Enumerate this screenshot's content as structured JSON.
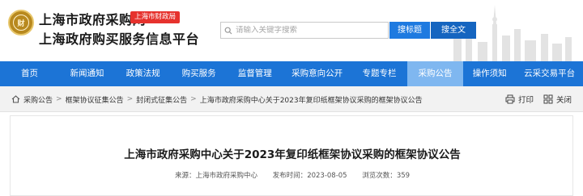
{
  "header": {
    "title_line1": "上海市政府采购网",
    "title_line2": "上海政府购买服务信息平台",
    "badge": "上海市财政局",
    "logo_text": "财"
  },
  "search": {
    "placeholder": "请输入关键字搜索",
    "btn_title": "搜标题",
    "btn_all": "搜全文"
  },
  "nav": {
    "items": [
      "首页",
      "新闻通知",
      "政策法规",
      "购买服务",
      "监督管理",
      "采购意向公开",
      "专题专栏",
      "采购公告",
      "操作须知",
      "云采交易平台"
    ],
    "active_index": 7
  },
  "breadcrumb": {
    "items": [
      "采购公告",
      "框架协议征集公告",
      "封闭式征集公告",
      "上海市政府采购中心关于2023年复印纸框架协议采购的框架协议公告"
    ]
  },
  "tools": {
    "print": "打印",
    "close": "关闭"
  },
  "article": {
    "title": "上海市政府采购中心关于2023年复印纸框架协议采购的框架协议公告",
    "source_label": "来源：",
    "source_value": "上海市政府采购中心",
    "date_label": "发布时间：",
    "date_value": "2023-08-05",
    "views_label": "浏览次数：",
    "views_value": "359"
  },
  "colors": {
    "nav_bg": "#1c74d6",
    "nav_active": "#7fb7f0",
    "badge": "#e6322d",
    "search_btn": "#1e7ae0"
  }
}
